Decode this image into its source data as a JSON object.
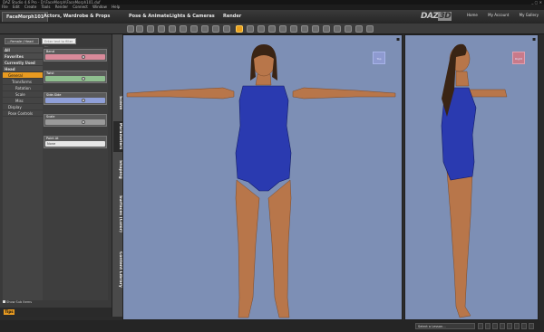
{
  "window": {
    "title": "DAZ Studio 4.6 Pro - D:\\FaceMorph\\FaceMorph101.duf",
    "controls": "_ ▢ ✕"
  },
  "menu": [
    "File",
    "Edit",
    "Create",
    "Tools",
    "Render",
    "Connect",
    "Window",
    "Help"
  ],
  "tabs": [
    {
      "label": "FaceMorph101",
      "active": true
    },
    {
      "label": "Actors, Wardrobe & Props",
      "active": false
    },
    {
      "label": "Pose & Animate",
      "active": false
    },
    {
      "label": "Lights & Cameras",
      "active": false
    },
    {
      "label": "Render",
      "active": false
    }
  ],
  "brand": {
    "daz": "DAZ",
    "three_d": "3D"
  },
  "right_links": [
    "Home",
    "My Account",
    "My Gallery"
  ],
  "left_panel": {
    "preset_button": "...Female / Head",
    "filter_placeholder": "Enter text to filter by...",
    "tree": [
      {
        "label": "All",
        "level": 0,
        "header": true
      },
      {
        "label": "Favorites",
        "level": 0,
        "header": true
      },
      {
        "label": "Currently Used",
        "level": 0,
        "header": true
      },
      {
        "label": "Head",
        "level": 0,
        "header": true
      },
      {
        "label": "General",
        "level": 1,
        "selected": true
      },
      {
        "label": "Transforms",
        "level": 2
      },
      {
        "label": "Rotation",
        "level": 3
      },
      {
        "label": "Scale",
        "level": 3
      },
      {
        "label": "Misc",
        "level": 3
      },
      {
        "label": "Display",
        "level": 1
      },
      {
        "label": "Pose Controls",
        "level": 1
      }
    ],
    "params": [
      {
        "label": "Bend",
        "color": "#d98a9a"
      },
      {
        "label": "Twist",
        "color": "#8fbf8f"
      },
      {
        "label": "Side-Side",
        "color": "#8f9fd8"
      },
      {
        "label": "Scale",
        "color": "#9a9a9a"
      }
    ],
    "point_at": "Point At",
    "point_at_value": "None",
    "show_sub": "Show Sub Items",
    "tips": "Tips"
  },
  "vertical_tabs": [
    {
      "label": "Scene",
      "active": false
    },
    {
      "label": "Parameters",
      "active": true
    },
    {
      "label": "Shaping",
      "active": false
    },
    {
      "label": "Surfaces (Color)",
      "active": false
    },
    {
      "label": "Content Library",
      "active": false
    }
  ],
  "viewports": {
    "main_cube": "Top",
    "side_cube": "Right"
  },
  "status": {
    "lesson_select": "Select a Lesson..."
  },
  "colors": {
    "accent": "#e89a20",
    "viewport_bg": "#7d8fb5",
    "swimsuit": "#2a3ab0",
    "skin": "#b8764a"
  }
}
